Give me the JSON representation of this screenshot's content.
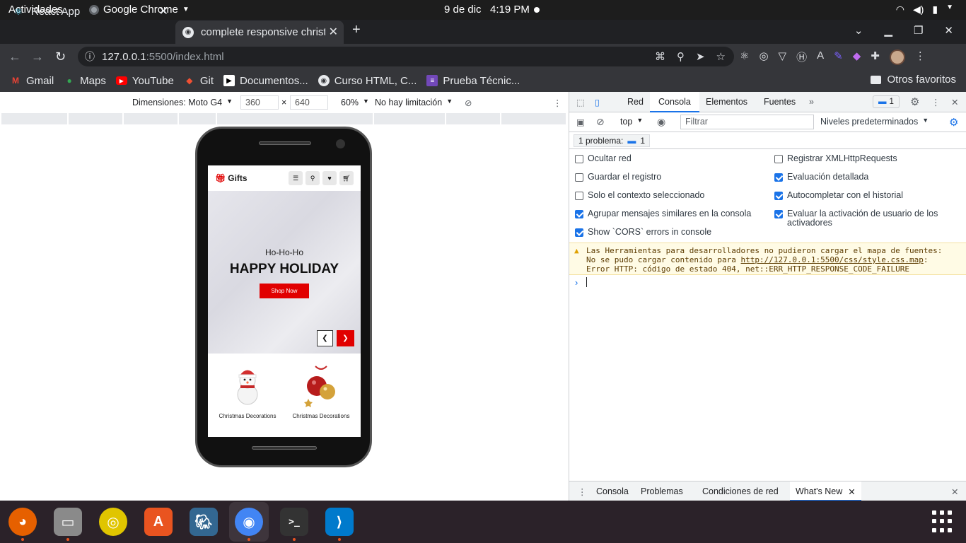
{
  "system_bar": {
    "activities": "Actividades",
    "app_name": "Google Chrome",
    "datetime": "9 de dic   4:19 PM"
  },
  "tabs": [
    {
      "label": "React App",
      "icon": "react-icon"
    },
    {
      "label": "complete responsive christmas website",
      "icon": "globe-icon"
    }
  ],
  "address_bar": {
    "host": "127.0.0.1",
    "path": ":5500/index.html"
  },
  "bookmarks": [
    {
      "label": "Gmail",
      "icon": "gmail-icon"
    },
    {
      "label": "Maps",
      "icon": "maps-icon"
    },
    {
      "label": "YouTube",
      "icon": "youtube-icon"
    },
    {
      "label": "Git",
      "icon": "git-icon"
    },
    {
      "label": "Documentos...",
      "icon": "document-icon"
    },
    {
      "label": "Curso HTML, C...",
      "icon": "globe-icon"
    },
    {
      "label": "Prueba Técnic...",
      "icon": "form-icon"
    }
  ],
  "other_bookmarks": "Otros favoritos",
  "device_toolbar": {
    "dimensions_label": "Dimensiones: Moto G4",
    "width": "360",
    "times": "×",
    "height": "640",
    "zoom": "60%",
    "throttle": "No hay limitación"
  },
  "site": {
    "logo": "Gifts",
    "hero_subtitle": "Ho-Ho-Ho",
    "hero_title": "HAPPY HOLIDAY",
    "shop_button": "Shop Now",
    "products": [
      {
        "label": "Christmas Decorations",
        "icon": "snowman-icon"
      },
      {
        "label": "Christmas Decorations",
        "icon": "ornaments-icon"
      }
    ]
  },
  "devtools": {
    "tabs": [
      "Red",
      "Consola",
      "Elementos",
      "Fuentes"
    ],
    "active_tab": "Consola",
    "issues_count": "1",
    "context": "top",
    "filter_placeholder": "Filtrar",
    "levels": "Niveles predeterminados",
    "problems_label": "1 problema:",
    "problems_count": "1",
    "options_left": [
      {
        "label": "Ocultar red",
        "checked": false
      },
      {
        "label": "Guardar el registro",
        "checked": false
      },
      {
        "label": "Solo el contexto seleccionado",
        "checked": false
      },
      {
        "label": "Agrupar mensajes similares en la consola",
        "checked": true
      },
      {
        "label": "Show `CORS` errors in console",
        "checked": true
      }
    ],
    "options_right": [
      {
        "label": "Registrar XMLHttpRequests",
        "checked": false
      },
      {
        "label": "Evaluación detallada",
        "checked": true
      },
      {
        "label": "Autocompletar con el historial",
        "checked": true
      },
      {
        "label": "Evaluar la activación de usuario de los activadores",
        "checked": true
      }
    ],
    "warning": {
      "line1": "Las Herramientas para desarrolladores no pudieron cargar el mapa de fuentes:",
      "line2_prefix": "No se pudo cargar contenido para ",
      "line2_link": "http://127.0.0.1:5500/css/style.css.map",
      "line2_suffix": ":",
      "line3": "Error HTTP: código de estado 404, net::ERR_HTTP_RESPONSE_CODE_FAILURE"
    },
    "prompt": "›",
    "drawer_tabs": [
      "Consola",
      "Problemas",
      "Condiciones de red",
      "What's New"
    ]
  },
  "dock": [
    {
      "name": "firefox",
      "icon": "firefox-icon",
      "color": "#e66000",
      "running": true
    },
    {
      "name": "files",
      "icon": "files-icon",
      "color": "#8a8a8a",
      "running": true
    },
    {
      "name": "rhythmbox",
      "icon": "rhythmbox-icon",
      "color": "#e0c500",
      "running": false
    },
    {
      "name": "software",
      "icon": "software-store-icon",
      "color": "#e95420",
      "running": false
    },
    {
      "name": "pgadmin",
      "icon": "postgres-icon",
      "color": "#336791",
      "running": false
    },
    {
      "name": "chrome",
      "icon": "chrome-icon",
      "color": "#4285f4",
      "running": true
    },
    {
      "name": "terminal",
      "icon": "terminal-icon",
      "color": "#333333",
      "running": true
    },
    {
      "name": "vscode",
      "icon": "vscode-icon",
      "color": "#007acc",
      "running": true
    }
  ]
}
